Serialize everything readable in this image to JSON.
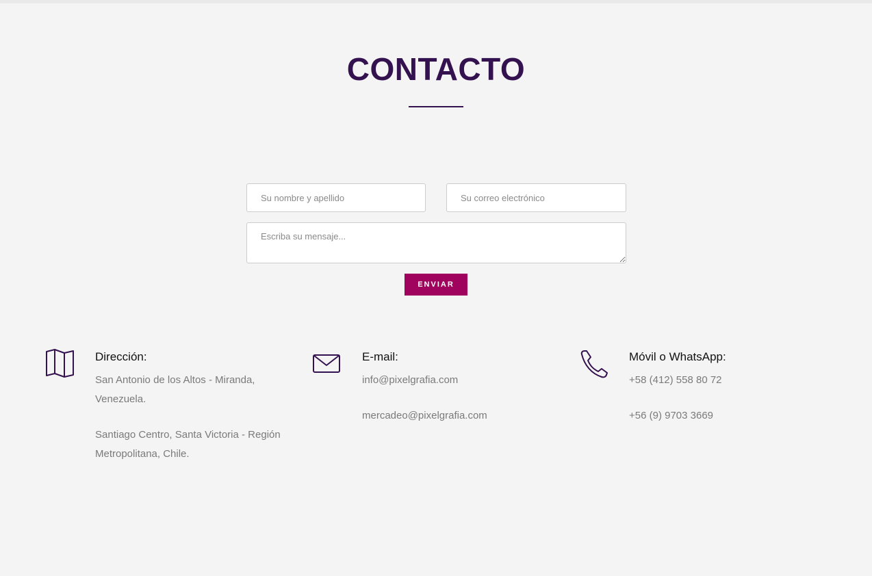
{
  "page": {
    "title": "CONTACTO"
  },
  "form": {
    "name_placeholder": "Su nombre y apellido",
    "email_placeholder": "Su correo electrónico",
    "message_placeholder": "Escriba su mensaje...",
    "submit_label": "ENVIAR"
  },
  "contact": {
    "address": {
      "icon": "map-icon",
      "heading": "Dirección:",
      "line1": "San Antonio de los Altos - Miranda, Venezuela.",
      "line2": "Santiago Centro, Santa Victoria - Región Metropolitana, Chile."
    },
    "email": {
      "icon": "envelope-icon",
      "heading": "E-mail:",
      "line1": "info@pixelgrafia.com",
      "line2": "mercadeo@pixelgrafia.com"
    },
    "phone": {
      "icon": "phone-icon",
      "heading": "Móvil o WhatsApp:",
      "line1": "+58 (412) 558 80 72",
      "line2": "+56 (9) 9703 3669"
    }
  },
  "colors": {
    "heading": "#34124f",
    "accent": "#a0035d",
    "background": "#f4f4f4",
    "body_text": "#7a7a7a"
  }
}
